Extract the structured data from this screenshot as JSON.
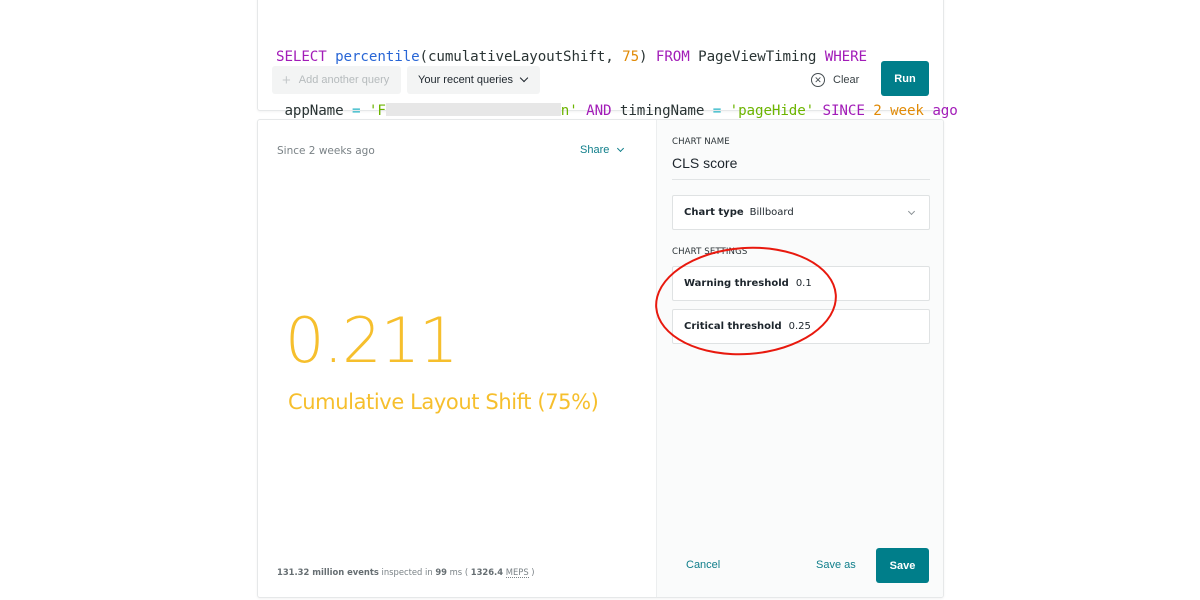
{
  "query": {
    "tokens_line1": [
      {
        "t": "SELECT",
        "c": "kw"
      },
      {
        "t": " ",
        "c": ""
      },
      {
        "t": "percentile",
        "c": "fn"
      },
      {
        "t": "(cumulativeLayoutShift, ",
        "c": ""
      },
      {
        "t": "75",
        "c": "num"
      },
      {
        "t": ") ",
        "c": ""
      },
      {
        "t": "FROM",
        "c": "kw"
      },
      {
        "t": " PageViewTiming ",
        "c": ""
      },
      {
        "t": "WHERE",
        "c": "kw"
      }
    ],
    "tokens_line2": [
      {
        "t": " appName ",
        "c": ""
      },
      {
        "t": "=",
        "c": "op"
      },
      {
        "t": " ",
        "c": ""
      },
      {
        "t": "'F",
        "c": "str"
      },
      {
        "t": "[redacted]",
        "c": "redact"
      },
      {
        "t": "n'",
        "c": "str"
      },
      {
        "t": " ",
        "c": ""
      },
      {
        "t": "AND",
        "c": "kw"
      },
      {
        "t": " timingName ",
        "c": ""
      },
      {
        "t": "=",
        "c": "op"
      },
      {
        "t": " ",
        "c": ""
      },
      {
        "t": "'pageHide'",
        "c": "str"
      },
      {
        "t": " ",
        "c": ""
      },
      {
        "t": "SINCE",
        "c": "kw"
      },
      {
        "t": " ",
        "c": ""
      },
      {
        "t": "2 week",
        "c": "num"
      },
      {
        "t": " ",
        "c": ""
      },
      {
        "t": "ago",
        "c": "kw"
      }
    ]
  },
  "toolbar": {
    "add_query_label": "Add another query",
    "recent_queries_label": "Your recent queries",
    "clear_label": "Clear",
    "run_label": "Run"
  },
  "result": {
    "since_label": "Since 2 weeks ago",
    "share_label": "Share",
    "billboard_value": "0.211",
    "billboard_label": "Cumulative Layout Shift (75%)",
    "billboard_color": "#f6bf2d",
    "stats": {
      "events": "131.32 million events",
      "inspected_in": " inspected in ",
      "ms_value": "99",
      "ms_unit": " ms ( ",
      "meps_value": "1326.4",
      "meps_label": "MEPS",
      "close": " )"
    }
  },
  "settings": {
    "chart_name_label": "CHART NAME",
    "chart_name_value": "CLS score",
    "chart_type_label": "Chart type",
    "chart_type_value": "Billboard",
    "chart_settings_label": "CHART SETTINGS",
    "warning_label": "Warning threshold",
    "warning_value": "0.1",
    "critical_label": "Critical threshold",
    "critical_value": "0.25",
    "cancel_label": "Cancel",
    "save_as_label": "Save as",
    "save_label": "Save"
  },
  "colors": {
    "accent": "#007e8a",
    "link": "#0f7e8a",
    "annotation": "#e8190e"
  }
}
